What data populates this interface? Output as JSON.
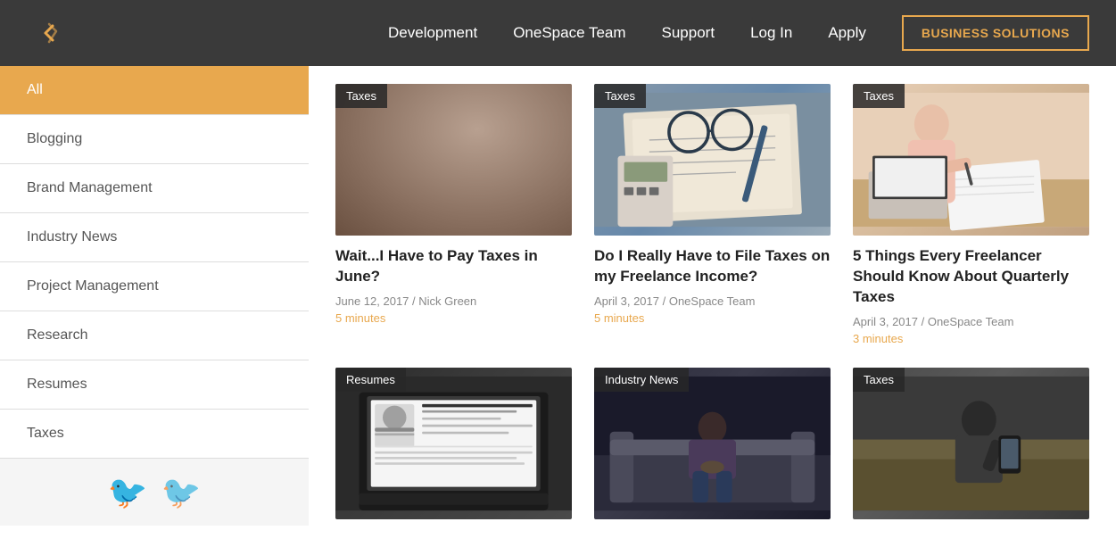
{
  "header": {
    "logo_alt": "OneSpace logo",
    "nav": [
      {
        "label": "Development",
        "href": "#"
      },
      {
        "label": "OneSpace Team",
        "href": "#"
      },
      {
        "label": "Support",
        "href": "#"
      },
      {
        "label": "Log In",
        "href": "#"
      },
      {
        "label": "Apply",
        "href": "#"
      }
    ],
    "cta_label": "BUSINESS SOLUTIONS"
  },
  "sidebar": {
    "items": [
      {
        "label": "All",
        "active": true
      },
      {
        "label": "Blogging",
        "active": false
      },
      {
        "label": "Brand Management",
        "active": false
      },
      {
        "label": "Industry News",
        "active": false
      },
      {
        "label": "Project Management",
        "active": false
      },
      {
        "label": "Research",
        "active": false
      },
      {
        "label": "Resumes",
        "active": false
      },
      {
        "label": "Taxes",
        "active": false
      }
    ]
  },
  "cards": [
    {
      "badge": "Taxes",
      "title": "Wait...I Have to Pay Taxes in June?",
      "date": "June 12, 2017",
      "author": "Nick Green",
      "read_time": "5 minutes",
      "img_class": "img-taxes-1"
    },
    {
      "badge": "Taxes",
      "title": "Do I Really Have to File Taxes on my Freelance Income?",
      "date": "April 3, 2017",
      "author": "OneSpace Team",
      "read_time": "5 minutes",
      "img_class": "img-taxes-2"
    },
    {
      "badge": "Taxes",
      "title": "5 Things Every Freelancer Should Know About Quarterly Taxes",
      "date": "April 3, 2017",
      "author": "OneSpace Team",
      "read_time": "3 minutes",
      "img_class": "img-taxes-3"
    },
    {
      "badge": "Resumes",
      "title": "",
      "date": "",
      "author": "",
      "read_time": "",
      "img_class": "img-resumes"
    },
    {
      "badge": "Industry News",
      "title": "",
      "date": "",
      "author": "",
      "read_time": "",
      "img_class": "img-industry"
    },
    {
      "badge": "Taxes",
      "title": "",
      "date": "",
      "author": "",
      "read_time": "",
      "img_class": "img-taxes-4"
    }
  ]
}
